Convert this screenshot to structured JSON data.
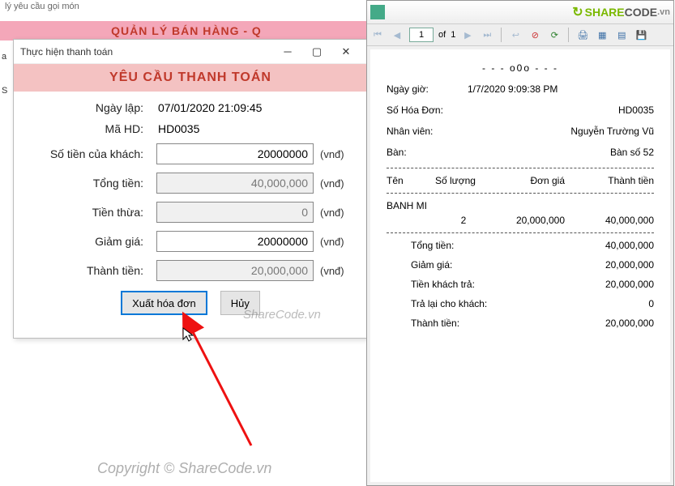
{
  "bg": {
    "title_fragment": "lý yêu cầu gọi món",
    "header_text": "QUẢN LÝ BÁN HÀNG - Q",
    "side_a": "a",
    "side_b": "S"
  },
  "dialog": {
    "window_title": "Thực hiện thanh toán",
    "header": "YÊU CẦU THANH TOÁN",
    "labels": {
      "date": "Ngày lập:",
      "code": "Mã HD:",
      "customer_money": "Số tiền của khách:",
      "total": "Tổng tiền:",
      "change": "Tiền thừa:",
      "discount": "Giảm giá:",
      "final": "Thành tiền:"
    },
    "values": {
      "date": "07/01/2020 21:09:45",
      "code": "HD0035",
      "customer_money": "20000000",
      "total": "40,000,000",
      "change": "0",
      "discount": "20000000",
      "final": "20,000,000",
      "unit": "(vnđ)"
    },
    "buttons": {
      "export": "Xuất hóa đơn",
      "cancel": "Hủy"
    }
  },
  "nav": {
    "page_input": "1",
    "of_label": "of",
    "page_total": "1"
  },
  "receipt": {
    "ooo": "- - - o0o - - -",
    "labels": {
      "datetime": "Ngày giờ:",
      "invoice": "Số Hóa Đơn:",
      "staff": "Nhân viên:",
      "table": "Bàn:"
    },
    "values": {
      "datetime": "1/7/2020 9:09:38 PM",
      "invoice": "HD0035",
      "staff": "Nguyễn Trường Vũ",
      "table": "Bàn số 52"
    },
    "columns": {
      "name": "Tên",
      "qty": "Số lượng",
      "price": "Đơn giá",
      "amount": "Thành tiền"
    },
    "item": {
      "name": "BANH MI",
      "qty": "2",
      "price": "20,000,000",
      "amount": "40,000,000"
    },
    "totals": {
      "total_lbl": "Tổng tiền:",
      "total_val": "40,000,000",
      "discount_lbl": "Giảm giá:",
      "discount_val": "20,000,000",
      "paid_lbl": "Tiền khách trả:",
      "paid_val": "20,000,000",
      "change_lbl": "Trả lại cho khách:",
      "change_val": "0",
      "final_lbl": "Thành tiền:",
      "final_val": "20,000,000"
    }
  },
  "brand": {
    "share": "SHARE",
    "code": "CODE",
    "tld": ".vn"
  },
  "watermark": {
    "small": "ShareCode.vn",
    "big": "Copyright © ShareCode.vn"
  }
}
